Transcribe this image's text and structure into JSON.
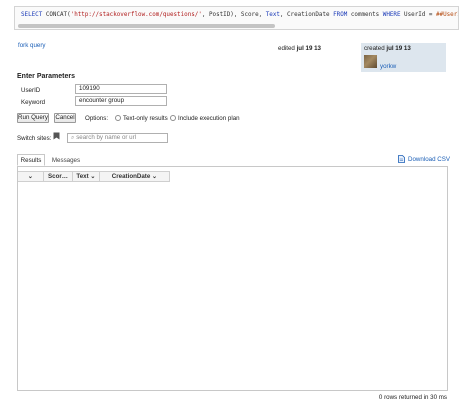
{
  "query": {
    "sql_parts": [
      {
        "t": "SELECT",
        "k": "kw"
      },
      {
        "t": " CONCAT(",
        "k": ""
      },
      {
        "t": "'http://stackoverflow.com/questions/'",
        "k": "str"
      },
      {
        "t": ", PostID), Score, ",
        "k": ""
      },
      {
        "t": "Text",
        "k": "kw"
      },
      {
        "t": ", CreationDate ",
        "k": ""
      },
      {
        "t": "FROM",
        "k": "kw"
      },
      {
        "t": " comments ",
        "k": ""
      },
      {
        "t": "WHERE",
        "k": "kw"
      },
      {
        "t": " UserId = ",
        "k": ""
      },
      {
        "t": "##UserId##",
        "k": "var"
      }
    ]
  },
  "fork_label": "fork query",
  "edited": {
    "prefix": "edited ",
    "date": "jul 19 13"
  },
  "created": {
    "prefix": "created ",
    "date": "jul 19 13",
    "user": "yorkw"
  },
  "params": {
    "title": "Enter Parameters",
    "fields": [
      {
        "label": "UserID",
        "value": "109190"
      },
      {
        "label": "Keyword",
        "value": "encounter group"
      }
    ]
  },
  "actions": {
    "run": "Run Query",
    "cancel": "Cancel",
    "options_label": "Options:",
    "text_only": "Text-only results",
    "exec_plan": "Include execution plan"
  },
  "switch": {
    "label": "Switch sites:",
    "placeholder": "search by name or url"
  },
  "tabs": {
    "results": "Results",
    "messages": "Messages"
  },
  "download": "Download CSV",
  "columns": [
    "",
    "Scor…",
    "Text",
    "CreationDate"
  ],
  "footer": "0 rows returned in 30 ms",
  "colors": {
    "link": "#1a5eb6",
    "created_bg": "#dde6ee"
  }
}
